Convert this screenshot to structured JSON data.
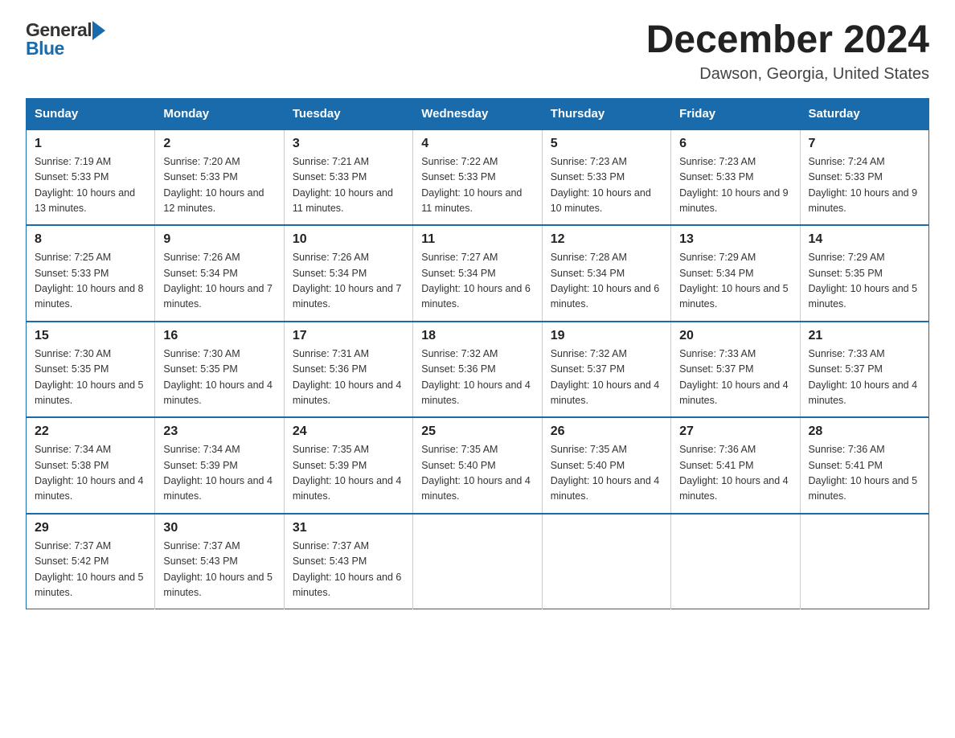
{
  "header": {
    "logo_general": "General",
    "logo_blue": "Blue",
    "title": "December 2024",
    "subtitle": "Dawson, Georgia, United States"
  },
  "days_of_week": [
    "Sunday",
    "Monday",
    "Tuesday",
    "Wednesday",
    "Thursday",
    "Friday",
    "Saturday"
  ],
  "weeks": [
    [
      {
        "day": "1",
        "sunrise": "7:19 AM",
        "sunset": "5:33 PM",
        "daylight": "10 hours and 13 minutes."
      },
      {
        "day": "2",
        "sunrise": "7:20 AM",
        "sunset": "5:33 PM",
        "daylight": "10 hours and 12 minutes."
      },
      {
        "day": "3",
        "sunrise": "7:21 AM",
        "sunset": "5:33 PM",
        "daylight": "10 hours and 11 minutes."
      },
      {
        "day": "4",
        "sunrise": "7:22 AM",
        "sunset": "5:33 PM",
        "daylight": "10 hours and 11 minutes."
      },
      {
        "day": "5",
        "sunrise": "7:23 AM",
        "sunset": "5:33 PM",
        "daylight": "10 hours and 10 minutes."
      },
      {
        "day": "6",
        "sunrise": "7:23 AM",
        "sunset": "5:33 PM",
        "daylight": "10 hours and 9 minutes."
      },
      {
        "day": "7",
        "sunrise": "7:24 AM",
        "sunset": "5:33 PM",
        "daylight": "10 hours and 9 minutes."
      }
    ],
    [
      {
        "day": "8",
        "sunrise": "7:25 AM",
        "sunset": "5:33 PM",
        "daylight": "10 hours and 8 minutes."
      },
      {
        "day": "9",
        "sunrise": "7:26 AM",
        "sunset": "5:34 PM",
        "daylight": "10 hours and 7 minutes."
      },
      {
        "day": "10",
        "sunrise": "7:26 AM",
        "sunset": "5:34 PM",
        "daylight": "10 hours and 7 minutes."
      },
      {
        "day": "11",
        "sunrise": "7:27 AM",
        "sunset": "5:34 PM",
        "daylight": "10 hours and 6 minutes."
      },
      {
        "day": "12",
        "sunrise": "7:28 AM",
        "sunset": "5:34 PM",
        "daylight": "10 hours and 6 minutes."
      },
      {
        "day": "13",
        "sunrise": "7:29 AM",
        "sunset": "5:34 PM",
        "daylight": "10 hours and 5 minutes."
      },
      {
        "day": "14",
        "sunrise": "7:29 AM",
        "sunset": "5:35 PM",
        "daylight": "10 hours and 5 minutes."
      }
    ],
    [
      {
        "day": "15",
        "sunrise": "7:30 AM",
        "sunset": "5:35 PM",
        "daylight": "10 hours and 5 minutes."
      },
      {
        "day": "16",
        "sunrise": "7:30 AM",
        "sunset": "5:35 PM",
        "daylight": "10 hours and 4 minutes."
      },
      {
        "day": "17",
        "sunrise": "7:31 AM",
        "sunset": "5:36 PM",
        "daylight": "10 hours and 4 minutes."
      },
      {
        "day": "18",
        "sunrise": "7:32 AM",
        "sunset": "5:36 PM",
        "daylight": "10 hours and 4 minutes."
      },
      {
        "day": "19",
        "sunrise": "7:32 AM",
        "sunset": "5:37 PM",
        "daylight": "10 hours and 4 minutes."
      },
      {
        "day": "20",
        "sunrise": "7:33 AM",
        "sunset": "5:37 PM",
        "daylight": "10 hours and 4 minutes."
      },
      {
        "day": "21",
        "sunrise": "7:33 AM",
        "sunset": "5:37 PM",
        "daylight": "10 hours and 4 minutes."
      }
    ],
    [
      {
        "day": "22",
        "sunrise": "7:34 AM",
        "sunset": "5:38 PM",
        "daylight": "10 hours and 4 minutes."
      },
      {
        "day": "23",
        "sunrise": "7:34 AM",
        "sunset": "5:39 PM",
        "daylight": "10 hours and 4 minutes."
      },
      {
        "day": "24",
        "sunrise": "7:35 AM",
        "sunset": "5:39 PM",
        "daylight": "10 hours and 4 minutes."
      },
      {
        "day": "25",
        "sunrise": "7:35 AM",
        "sunset": "5:40 PM",
        "daylight": "10 hours and 4 minutes."
      },
      {
        "day": "26",
        "sunrise": "7:35 AM",
        "sunset": "5:40 PM",
        "daylight": "10 hours and 4 minutes."
      },
      {
        "day": "27",
        "sunrise": "7:36 AM",
        "sunset": "5:41 PM",
        "daylight": "10 hours and 4 minutes."
      },
      {
        "day": "28",
        "sunrise": "7:36 AM",
        "sunset": "5:41 PM",
        "daylight": "10 hours and 5 minutes."
      }
    ],
    [
      {
        "day": "29",
        "sunrise": "7:37 AM",
        "sunset": "5:42 PM",
        "daylight": "10 hours and 5 minutes."
      },
      {
        "day": "30",
        "sunrise": "7:37 AM",
        "sunset": "5:43 PM",
        "daylight": "10 hours and 5 minutes."
      },
      {
        "day": "31",
        "sunrise": "7:37 AM",
        "sunset": "5:43 PM",
        "daylight": "10 hours and 6 minutes."
      },
      null,
      null,
      null,
      null
    ]
  ],
  "labels": {
    "sunrise": "Sunrise:",
    "sunset": "Sunset:",
    "daylight": "Daylight:"
  }
}
